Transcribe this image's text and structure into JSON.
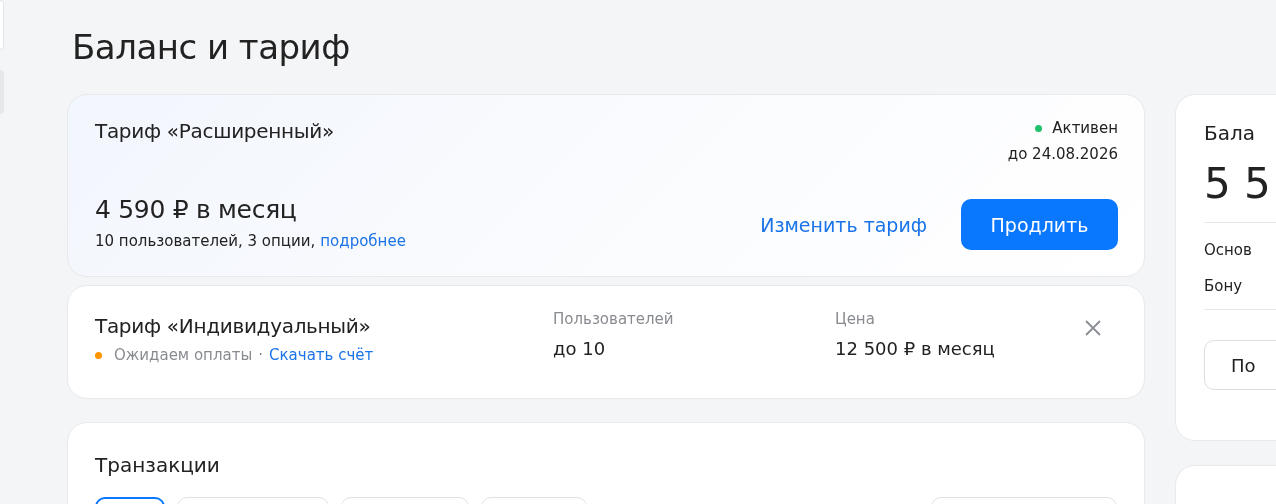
{
  "page_title": "Баланс и тариф",
  "current_plan": {
    "name": "Тариф «Расширенный»",
    "status": {
      "label": "Активен",
      "color": "#1fc16b"
    },
    "valid_until": "до 24.08.2026",
    "price": "4 590 ₽ в месяц",
    "details": "10 пользователей, 3 опции,",
    "details_link": "подробнее",
    "change_link": "Изменить тариф",
    "extend_button": "Продлить"
  },
  "pending_plan": {
    "name": "Тариф «Индивидуальный»",
    "status": {
      "label": "Ожидаем оплаты",
      "color": "#ff9500"
    },
    "separator": "·",
    "download_link": "Скачать счёт",
    "fields": [
      {
        "label": "Пользователей",
        "value": "до 10"
      },
      {
        "label": "Цена",
        "value": "12 500 ₽ в месяц"
      }
    ]
  },
  "transactions": {
    "title": "Транзакции",
    "filters": [
      {
        "selected": true
      },
      {
        "selected": false
      },
      {
        "selected": false
      },
      {
        "selected": false
      }
    ]
  },
  "balance_card": {
    "title": "Бала",
    "amount": "5 5",
    "rows": [
      "Основ",
      "Бону"
    ],
    "button": "По"
  }
}
